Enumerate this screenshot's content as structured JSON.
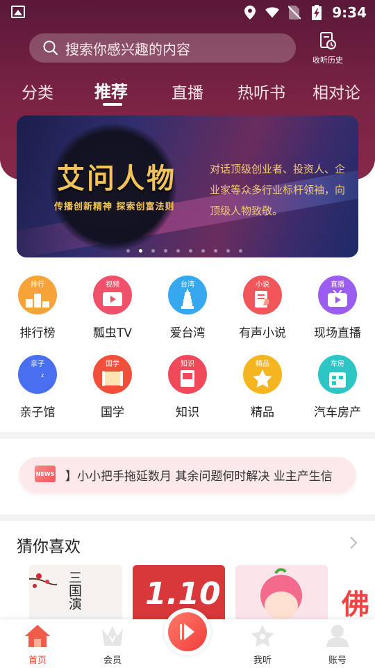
{
  "status_bar": {
    "time": "9:34",
    "icons": [
      "gallery-icon",
      "location-icon",
      "wifi-icon",
      "no-sim-icon",
      "battery-charging-icon"
    ]
  },
  "search": {
    "placeholder": "搜索你感兴趣的内容",
    "history_label": "收听历史"
  },
  "tabs": [
    {
      "label": "分类",
      "active": false
    },
    {
      "label": "推荐",
      "active": true
    },
    {
      "label": "直播",
      "active": false
    },
    {
      "label": "热听书",
      "active": false
    },
    {
      "label": "相对论",
      "active": false
    }
  ],
  "banner": {
    "title": "艾问人物",
    "slogan": "传播创新精神 探索创富法则",
    "description": "对话顶级创业者、投资人、企业家等众多行业标杆领袖，向顶级人物致敬。",
    "dot_count": 10,
    "active_dot": 1
  },
  "categories": [
    {
      "name": "排行榜",
      "tag": "排行",
      "color": "#f7a33a"
    },
    {
      "name": "瓢虫TV",
      "tag": "视频",
      "color": "#f0506a"
    },
    {
      "name": "爱台湾",
      "tag": "台湾",
      "color": "#35a8f0"
    },
    {
      "name": "有声小说",
      "tag": "小说",
      "color": "#f0565a"
    },
    {
      "name": "现场直播",
      "tag": "直播",
      "color": "#9b5cf0"
    },
    {
      "name": "亲子馆",
      "tag": "亲子",
      "color": "#4a6ef0"
    },
    {
      "name": "国学",
      "tag": "国学",
      "color": "#f0503a"
    },
    {
      "name": "知识",
      "tag": "知识",
      "color": "#f04a5a"
    },
    {
      "name": "精品",
      "tag": "精品",
      "color": "#f5b521"
    },
    {
      "name": "汽车房产",
      "tag": "车房",
      "color": "#2ec5c5"
    }
  ],
  "ticker": {
    "badge": "NEWS",
    "text": "】小小把手拖延数月 其余问题何时解决 业主产生信"
  },
  "guess": {
    "title": "猜你喜欢",
    "cards": [
      {
        "text": "三国演",
        "color": "#f5f2f0"
      },
      {
        "text": "1.10",
        "color": "#d8383a"
      },
      {
        "text": "",
        "color": "#fbe4ea"
      },
      {
        "text": "佛",
        "color": "#ffffff"
      }
    ]
  },
  "bottom_nav": [
    {
      "label": "首页",
      "icon": "home-icon",
      "active": true
    },
    {
      "label": "会员",
      "icon": "crown-icon",
      "active": false
    },
    {
      "label": "我听",
      "icon": "star-icon",
      "active": false
    },
    {
      "label": "账号",
      "icon": "user-icon",
      "active": false
    }
  ],
  "accent_color": "#e8453c"
}
